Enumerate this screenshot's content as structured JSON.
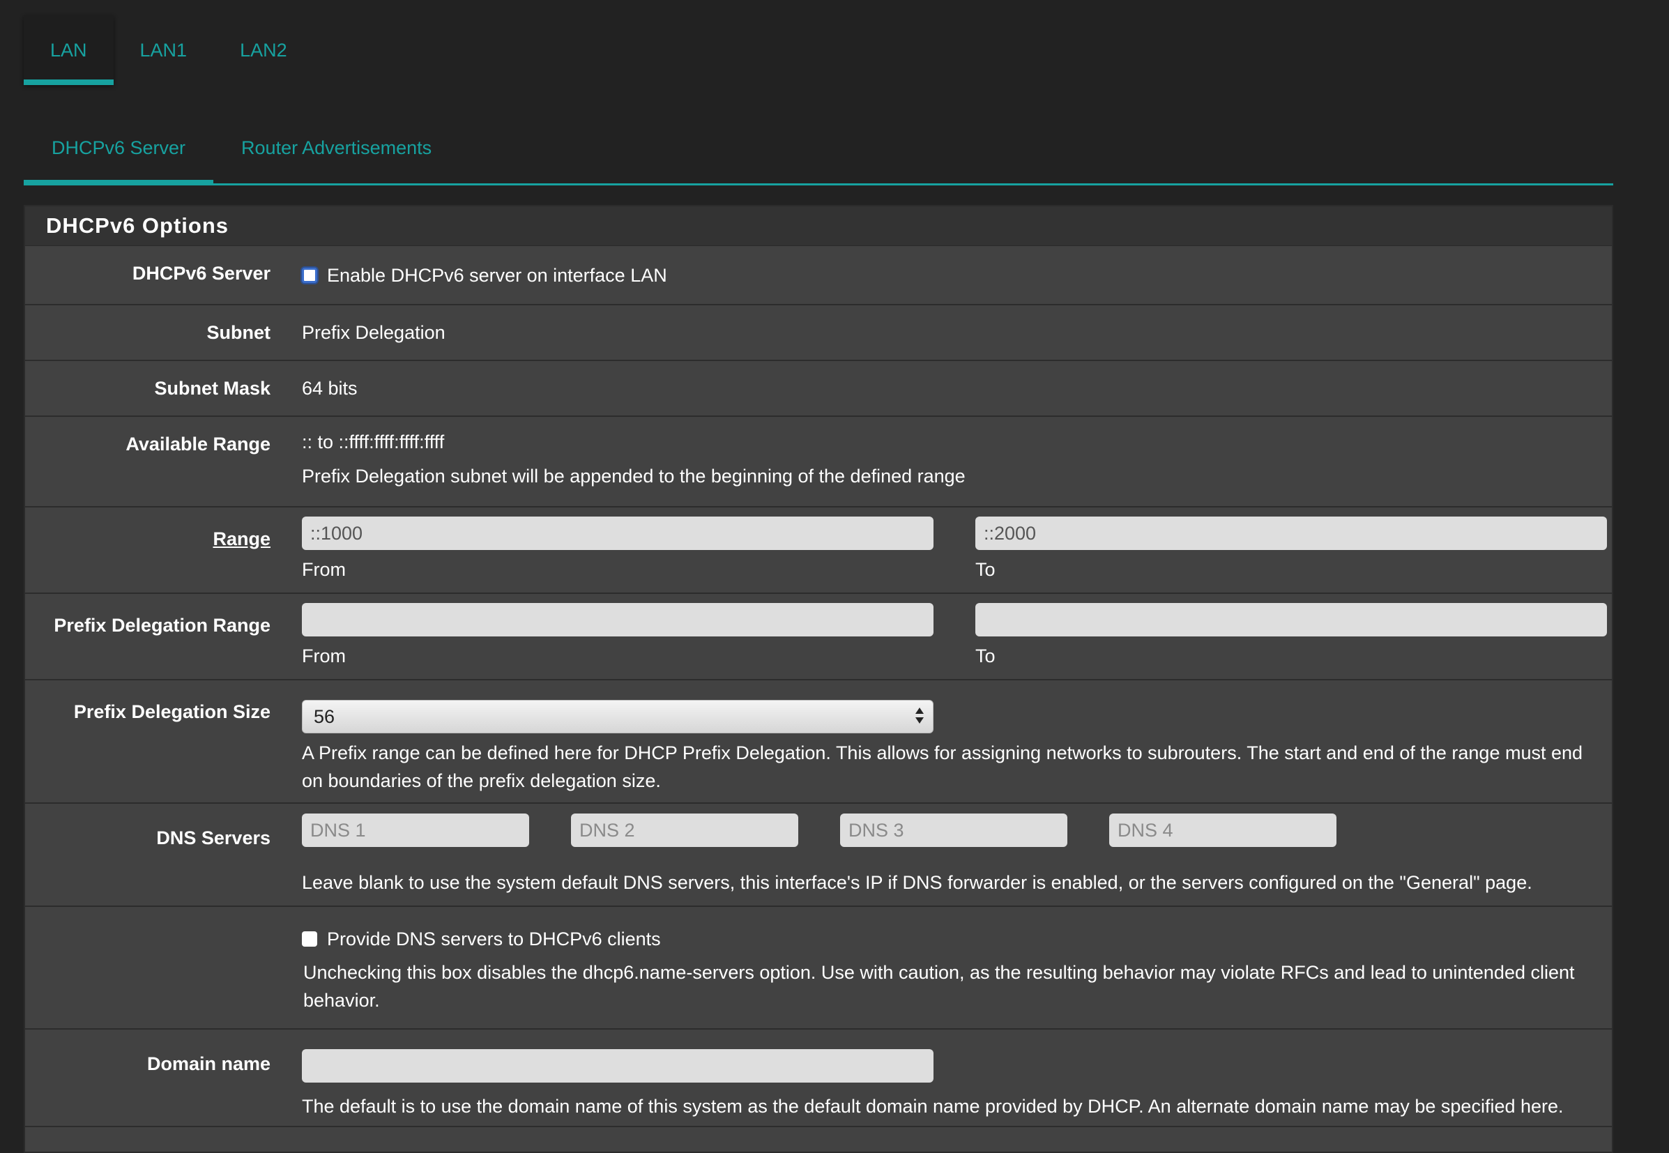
{
  "interface_tabs": [
    {
      "label": "LAN",
      "active": true
    },
    {
      "label": "LAN1",
      "active": false
    },
    {
      "label": "LAN2",
      "active": false
    }
  ],
  "sub_tabs": [
    {
      "label": "DHCPv6 Server",
      "active": true
    },
    {
      "label": "Router Advertisements",
      "active": false
    }
  ],
  "panel": {
    "title": "DHCPv6 Options",
    "dhcpv6_server": {
      "label": "DHCPv6 Server",
      "checkbox_label": "Enable DHCPv6 server on interface LAN",
      "checked": false
    },
    "subnet": {
      "label": "Subnet",
      "value": "Prefix Delegation"
    },
    "subnet_mask": {
      "label": "Subnet Mask",
      "value": "64 bits"
    },
    "available_range": {
      "label": "Available Range",
      "value": ":: to ::ffff:ffff:ffff:ffff",
      "help": "Prefix Delegation subnet will be appended to the beginning of the defined range"
    },
    "range": {
      "label": "Range",
      "from_value": "::1000",
      "to_value": "::2000",
      "from_label": "From",
      "to_label": "To"
    },
    "prefix_delegation_range": {
      "label": "Prefix Delegation Range",
      "from_value": "",
      "to_value": "",
      "from_label": "From",
      "to_label": "To"
    },
    "prefix_delegation_size": {
      "label": "Prefix Delegation Size",
      "selected": "56",
      "help": "A Prefix range can be defined here for DHCP Prefix Delegation. This allows for assigning networks to subrouters. The start and end of the range must end on boundaries of the prefix delegation size."
    },
    "dns_servers": {
      "label": "DNS Servers",
      "placeholders": [
        "DNS 1",
        "DNS 2",
        "DNS 3",
        "DNS 4"
      ],
      "help": "Leave blank to use the system default DNS servers, this interface's IP if DNS forwarder is enabled, or the servers configured on the \"General\" page."
    },
    "provide_dns": {
      "checkbox_label": "Provide DNS servers to DHCPv6 clients",
      "checked": false,
      "help": "Unchecking this box disables the dhcp6.name-servers option. Use with caution, as the resulting behavior may violate RFCs and lead to unintended client behavior."
    },
    "domain_name": {
      "label": "Domain name",
      "value": "",
      "help": "The default is to use the domain name of this system as the default domain name provided by DHCP. An alternate domain name may be specified here."
    }
  },
  "colors": {
    "accent": "#17a2a0",
    "page_bg": "#222222",
    "panel_bg": "#424242",
    "heading_bg": "#333333",
    "input_bg": "#dedede"
  }
}
